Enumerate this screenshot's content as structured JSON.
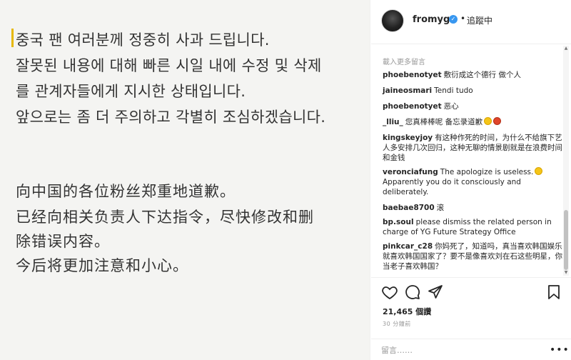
{
  "post": {
    "korean_lines": [
      "중국 팬 여러분께 정중히 사과 드립니다.",
      "잘못된 내용에 대해 빠른 시일 내에 수정 및 삭제",
      "를 관계자들에게 지시한 상태입니다.",
      "앞으로는 좀 더 주의하고 각별히 조심하겠습니다."
    ],
    "chinese_lines": [
      "向中国的各位粉丝郑重地道歉。",
      "已经向相关负责人下达指令，尽快修改和删",
      "除错误内容。",
      "今后将更加注意和小心。"
    ]
  },
  "header": {
    "username": "fromyg",
    "separator": "•",
    "follow_status": "追蹤中"
  },
  "comments": {
    "load_more": "載入更多留言",
    "items": [
      {
        "user": "phoebenotyet",
        "text": "敷衍成这个德行 做个人"
      },
      {
        "user": "jaineosmari",
        "text": "Tendi tudo"
      },
      {
        "user": "phoebenotyet",
        "text": "恶心"
      },
      {
        "user": "_lliu_",
        "text": "您真棒棒呢 备忘录道歉"
      },
      {
        "user": "kingskeyjoy",
        "text": "有这种作死的时间，为什么不给旗下艺人多安排几次回归，这种无聊的情景剧就是在浪费时间和金钱"
      },
      {
        "user": "veronciafung",
        "text": "The apologize is useless."
      },
      {
        "user": "",
        "text": "Apparently you do it consciously and deliberately."
      },
      {
        "user": "baebae8700",
        "text": "滚"
      },
      {
        "user": "bp.soul",
        "text": "please dismiss the related person in charge of YG Future Strategy Office"
      },
      {
        "user": "pinkcar_c28",
        "text": "你妈死了，知道吗，真当喜欢韩国娱乐就喜欢韩国国家了？要不是像喜欢刘在石这些明星，你当老子喜欢韩国？"
      }
    ]
  },
  "stats": {
    "likes": "21,465 個讚",
    "timestamp": "30 分鐘前"
  },
  "comment_box": {
    "placeholder": "留言……",
    "more": "•••"
  }
}
